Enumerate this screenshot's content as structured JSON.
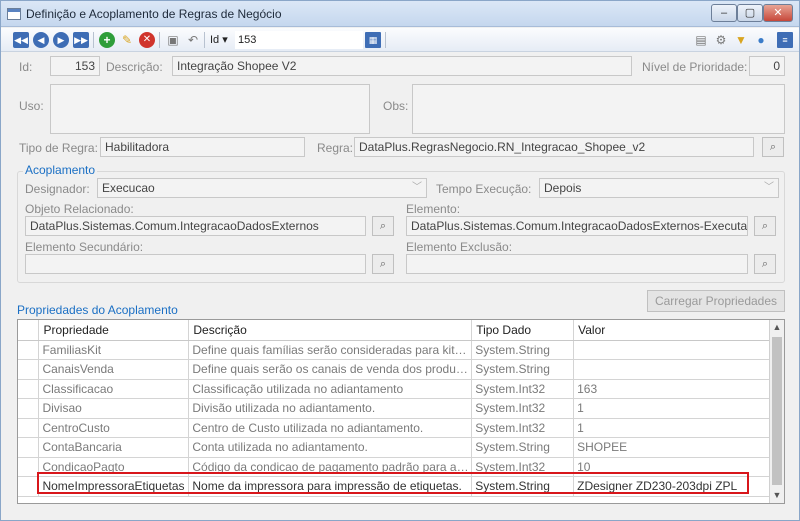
{
  "window": {
    "title": "Definição e Acoplamento de Regras de Negócio",
    "controls": {
      "minimize": "–",
      "maximize": "▢",
      "close": "✕"
    }
  },
  "toolbar": {
    "id_label": "Id ▾",
    "id_value": "153",
    "icons": [
      "first-icon",
      "previous-icon",
      "next-icon",
      "last-icon",
      "add-icon",
      "edit-icon",
      "delete-icon",
      "save-icon",
      "undo-icon",
      "export-icon",
      "print-icon",
      "settings-icon",
      "filter-icon",
      "user-icon",
      "menu-icon"
    ]
  },
  "header": {
    "id_label": "Id:",
    "id_value": "153",
    "descricao_label": "Descrição:",
    "descricao_value": "Integração Shopee V2",
    "prioridade_label": "Nível de Prioridade:",
    "prioridade_value": "0",
    "uso_label": "Uso:",
    "uso_value": "",
    "obs_label": "Obs:",
    "obs_value": "",
    "tipo_regra_label": "Tipo de Regra:",
    "tipo_regra_value": "Habilitadora",
    "regra_label": "Regra:",
    "regra_value": "DataPlus.RegrasNegocio.RN_Integracao_Shopee_v2"
  },
  "acoplamento": {
    "title": "Acoplamento",
    "designador_label": "Designador:",
    "designador_value": "Execucao",
    "tempo_label": "Tempo Execução:",
    "tempo_value": "Depois",
    "objeto_label": "Objeto Relacionado:",
    "objeto_value": "DataPlus.Sistemas.Comum.IntegracaoDadosExternos",
    "elemento_label": "Elemento:",
    "elemento_value": "DataPlus.Sistemas.Comum.IntegracaoDadosExternos-ExecutaOp",
    "elemento_sec_label": "Elemento Secundário:",
    "elemento_sec_value": "",
    "elemento_exc_label": "Elemento Exclusão:",
    "elemento_exc_value": ""
  },
  "propriedades": {
    "title": "Propriedades do Acoplamento",
    "load_button": "Carregar Propriedades",
    "columns": [
      "Propriedade",
      "Descrição",
      "Tipo Dado",
      "Valor"
    ],
    "rows": [
      [
        "FamiliasKit",
        "Define quais famílias serão consideradas para kits n...",
        "System.String",
        ""
      ],
      [
        "CanaisVenda",
        "Define quais serão os canais de venda dos produto...",
        "System.String",
        ""
      ],
      [
        "Classificacao",
        "Classificação utilizada no adiantamento",
        "System.Int32",
        "163"
      ],
      [
        "Divisao",
        "Divisão utilizada no adiantamento.",
        "System.Int32",
        "1"
      ],
      [
        "CentroCusto",
        "Centro de Custo utilizada no adiantamento.",
        "System.Int32",
        "1"
      ],
      [
        "ContaBancaria",
        "Conta utilizada no adiantamento.",
        "System.String",
        "SHOPEE"
      ],
      [
        "CondicaoPagto",
        "Código da condicao de pagamento padrão para a g...",
        "System.Int32",
        "10"
      ],
      [
        "NomeImpressoraEtiquetas",
        "Nome da impressora para impressão de etiquetas.",
        "System.String",
        "ZDesigner ZD230-203dpi ZPL"
      ]
    ]
  }
}
